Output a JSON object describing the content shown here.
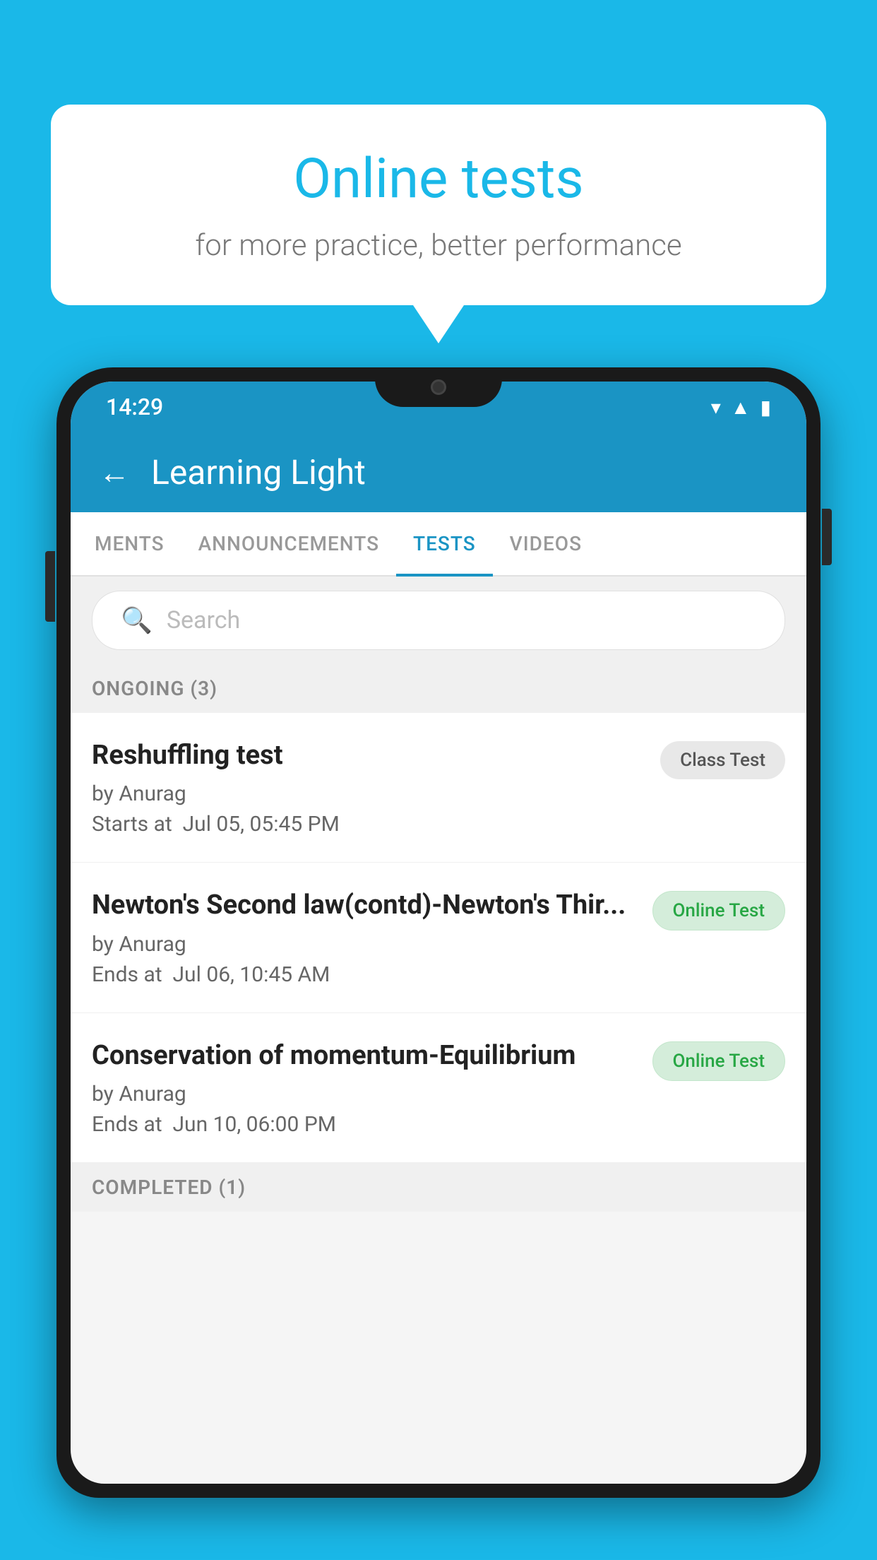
{
  "background_color": "#1ab8e8",
  "speech_bubble": {
    "title": "Online tests",
    "subtitle": "for more practice, better performance"
  },
  "status_bar": {
    "time": "14:29",
    "icons": [
      "wifi",
      "signal",
      "battery"
    ]
  },
  "app_header": {
    "title": "Learning Light",
    "back_label": "←"
  },
  "tabs": [
    {
      "label": "MENTS",
      "active": false
    },
    {
      "label": "ANNOUNCEMENTS",
      "active": false
    },
    {
      "label": "TESTS",
      "active": true
    },
    {
      "label": "VIDEOS",
      "active": false
    }
  ],
  "search": {
    "placeholder": "Search"
  },
  "sections": [
    {
      "header": "ONGOING (3)",
      "tests": [
        {
          "title": "Reshuffling test",
          "author": "by Anurag",
          "time_label": "Starts at",
          "time": "Jul 05, 05:45 PM",
          "badge": "Class Test",
          "badge_type": "class"
        },
        {
          "title": "Newton's Second law(contd)-Newton's Thir...",
          "author": "by Anurag",
          "time_label": "Ends at",
          "time": "Jul 06, 10:45 AM",
          "badge": "Online Test",
          "badge_type": "online"
        },
        {
          "title": "Conservation of momentum-Equilibrium",
          "author": "by Anurag",
          "time_label": "Ends at",
          "time": "Jun 10, 06:00 PM",
          "badge": "Online Test",
          "badge_type": "online"
        }
      ]
    }
  ],
  "completed_header": "COMPLETED (1)"
}
